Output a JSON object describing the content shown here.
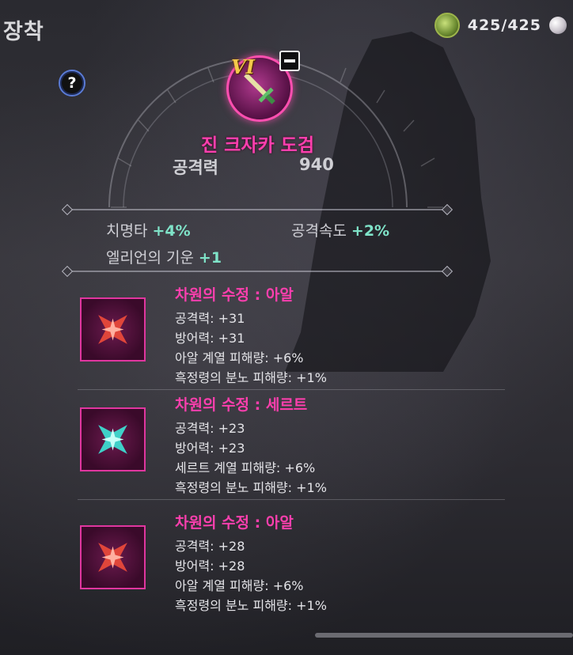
{
  "header": {
    "title": "장착",
    "help_label": "?"
  },
  "resource": {
    "icon": "green-gem-icon",
    "value": "425/425",
    "pearl_icon": "pearl-icon"
  },
  "weapon": {
    "icon": "sword-icon",
    "tier": "VI",
    "name": "진 크자카 도검",
    "attack_label": "공격력",
    "attack_value": "940",
    "unequip_icon": "minus-icon"
  },
  "substats": [
    {
      "label": "치명타",
      "value": "+4%"
    },
    {
      "label": "공격속도",
      "value": "+2%"
    },
    {
      "label": "엘리언의 기운",
      "value": "+1"
    }
  ],
  "gems": [
    {
      "name": "차원의 수정 : 아알",
      "color": "#e0463a",
      "lines": [
        "공격력: +31",
        "방어력: +31",
        "아알 계열 피해량: +6%",
        "흑정령의 분노 피해량: +1%"
      ]
    },
    {
      "name": "차원의 수정 : 세르트",
      "color": "#3fd0c8",
      "lines": [
        "공격력: +23",
        "방어력: +23",
        "세르트 계열 피해량: +6%",
        "흑정령의 분노 피해량: +1%"
      ]
    },
    {
      "name": "차원의 수정 : 아알",
      "color": "#e0463a",
      "lines": [
        "공격력: +28",
        "방어력: +28",
        "아알 계열 피해량: +6%",
        "흑정령의 분노 피해량: +1%"
      ]
    }
  ]
}
